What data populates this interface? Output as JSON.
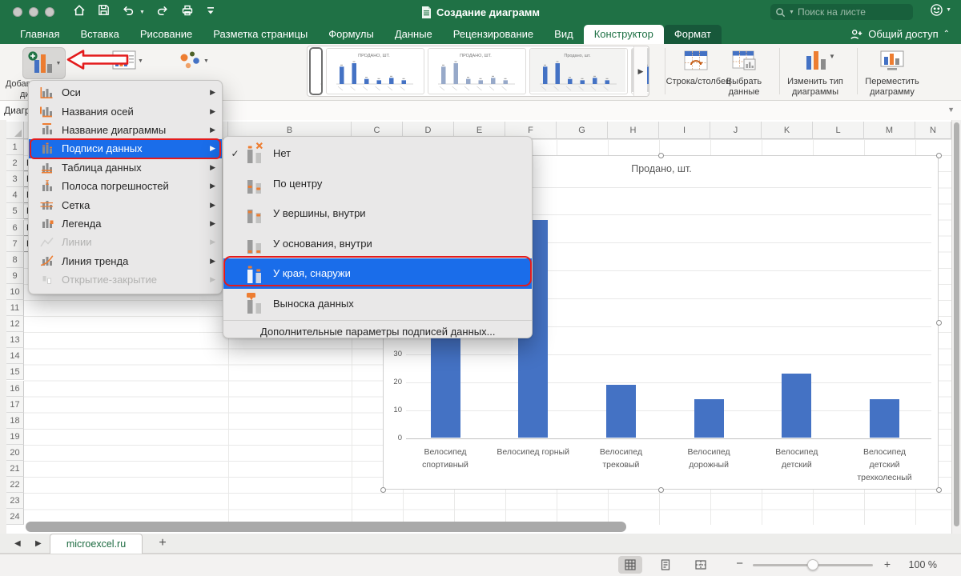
{
  "titlebar": {
    "title": "Создание диаграмм",
    "search_placeholder": "Поиск на листе"
  },
  "tabbar": {
    "tabs": [
      {
        "label": "Главная"
      },
      {
        "label": "Вставка"
      },
      {
        "label": "Рисование"
      },
      {
        "label": "Разметка страницы"
      },
      {
        "label": "Формулы"
      },
      {
        "label": "Данные"
      },
      {
        "label": "Рецензирование"
      },
      {
        "label": "Вид"
      },
      {
        "label": "Конструктор",
        "state": "active"
      },
      {
        "label": "Формат",
        "state": "dark"
      }
    ],
    "share_label": "Общий доступ"
  },
  "ribbon": {
    "add_element": {
      "line1": "Добавить элемент",
      "line2": "диаграммы"
    },
    "gallery_arrow": "▶",
    "actions": [
      {
        "line1": "Строка/столбец",
        "line2": ""
      },
      {
        "line1": "Выбрать",
        "line2": "данные"
      },
      {
        "line1": "Изменить тип",
        "line2": "диаграммы"
      },
      {
        "line1": "Переместить",
        "line2": "диаграмму"
      }
    ]
  },
  "formula_bar": {
    "name_box": "Диаграмма"
  },
  "menu": {
    "items": [
      {
        "label": "Оси",
        "icon": "axes"
      },
      {
        "label": "Названия осей",
        "icon": "axis-titles"
      },
      {
        "label": "Название диаграммы",
        "icon": "chart-title"
      },
      {
        "label": "Подписи данных",
        "icon": "data-labels",
        "selected": true,
        "red_outline": true
      },
      {
        "label": "Таблица данных",
        "icon": "data-table"
      },
      {
        "label": "Полоса погрешностей",
        "icon": "error-bars"
      },
      {
        "label": "Сетка",
        "icon": "gridlines"
      },
      {
        "label": "Легенда",
        "icon": "legend"
      },
      {
        "label": "Линии",
        "icon": "lines",
        "disabled": true
      },
      {
        "label": "Линия тренда",
        "icon": "trendline"
      },
      {
        "label": "Открытие-закрытие",
        "icon": "up-down-bars",
        "disabled": true
      }
    ]
  },
  "submenu": {
    "items": [
      {
        "label": "Нет",
        "icon": "none",
        "checked": true
      },
      {
        "label": "По центру",
        "icon": "center"
      },
      {
        "label": "У вершины, внутри",
        "icon": "inside-end"
      },
      {
        "label": "У основания, внутри",
        "icon": "inside-base"
      },
      {
        "label": "У края, снаружи",
        "icon": "outside-end",
        "selected": true,
        "red_outline": true
      },
      {
        "label": "Выноска данных",
        "icon": "callout"
      }
    ],
    "footer": "Дополнительные параметры подписей данных..."
  },
  "grid": {
    "columns": [
      "A",
      "B",
      "C",
      "D",
      "E",
      "F",
      "G",
      "H",
      "I",
      "J",
      "K",
      "L",
      "M",
      "N"
    ],
    "rows": {
      "first": 1,
      "last": 24
    }
  },
  "sheet": {
    "column_a_from_row2": [
      "Велосипед спортивный",
      "Велосипед горный",
      "Велосипед трековый",
      "Велосипед дорожный",
      "Велосипед детский",
      "Велосипед детский трехколесный"
    ]
  },
  "chart_data": {
    "type": "bar",
    "title": "Продано, шт.",
    "categories": [
      "Велосипед спортивный",
      "Велосипед горный",
      "Велосипед трековый",
      "Велосипед дорожный",
      "Велосипед детский",
      "Велосипед детский трехколесный"
    ],
    "category_lines": [
      [
        "Велосипед",
        "спортивный"
      ],
      [
        "Велосипед горный"
      ],
      [
        "Велосипед",
        "трековый"
      ],
      [
        "Велосипед",
        "дорожный"
      ],
      [
        "Велосипед",
        "детский"
      ],
      [
        "Велосипед",
        "детский",
        "трехколесный"
      ]
    ],
    "values": [
      65,
      78,
      19,
      14,
      23,
      14
    ],
    "xlabel": "",
    "ylabel": "",
    "ylim": [
      0,
      90
    ],
    "ytick_step": 10,
    "visible_ytick_labels": [
      0,
      10,
      20,
      30
    ],
    "grid": true,
    "legend": "none",
    "bar_color": "#4472c4"
  },
  "sheet_tabs": {
    "active_tab": "microexcel.ru",
    "add_label": "+"
  },
  "status": {
    "zoom_label": "100 %"
  },
  "colors": {
    "title_green": "#1f7145",
    "menu_select_blue": "#1a6dea",
    "annotation_red": "#e31b1c",
    "bar_blue": "#4472c4",
    "accent_orange": "#ed7d31"
  }
}
